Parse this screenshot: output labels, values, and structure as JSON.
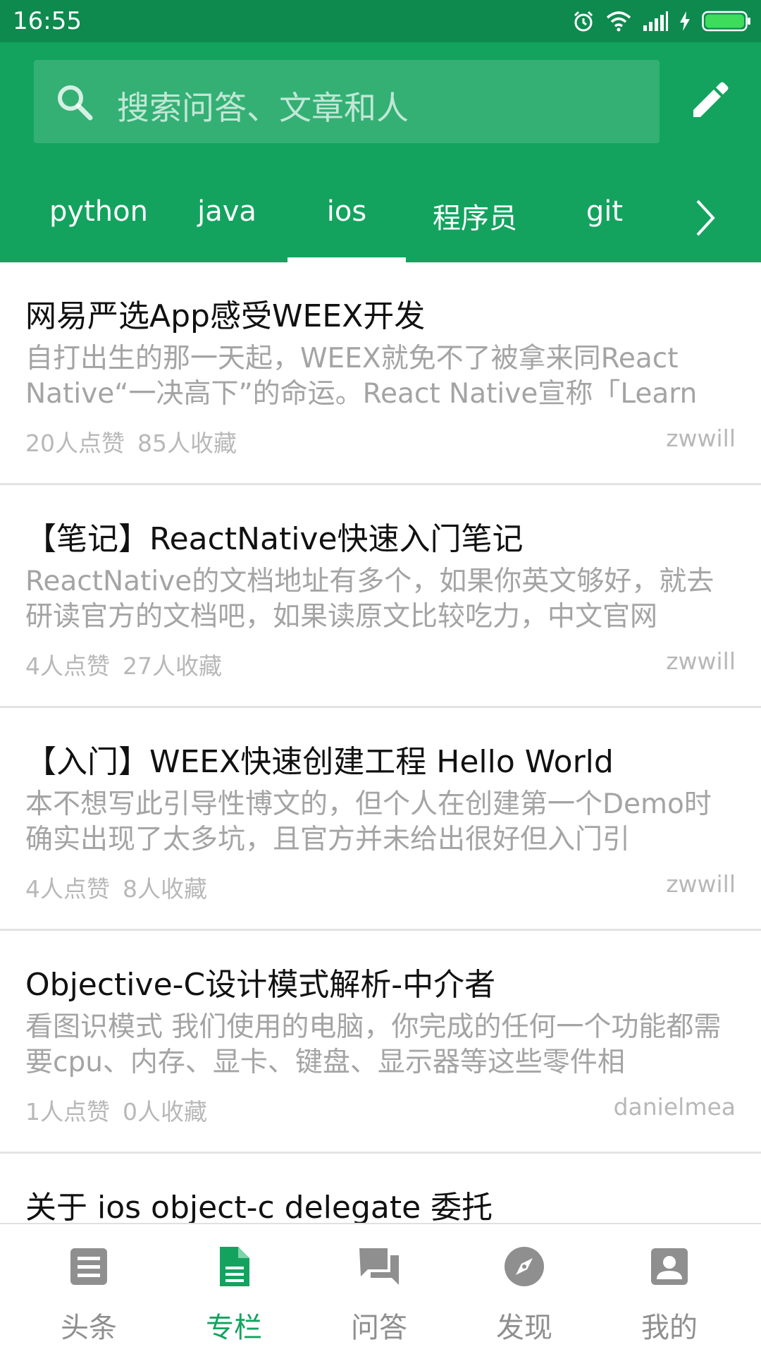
{
  "status_bar": {
    "time": "16:55",
    "icons": [
      "alarm-icon",
      "wifi-icon",
      "signal-icon",
      "charging-icon",
      "battery-icon"
    ],
    "battery_color": "#3ddc5a"
  },
  "colors": {
    "brand": "#13a35f",
    "status_bar": "#0e8a4f",
    "text_primary": "#111111",
    "text_secondary": "#a4a4a4",
    "nav_inactive": "#8f8f8f"
  },
  "search": {
    "placeholder": "搜索问答、文章和人",
    "icon": "search-icon",
    "action_icon": "edit-icon"
  },
  "tabs": [
    {
      "label": "python",
      "active": false
    },
    {
      "label": "java",
      "active": false
    },
    {
      "label": "ios",
      "active": true
    },
    {
      "label": "程序员",
      "active": false
    },
    {
      "label": "git",
      "active": false
    }
  ],
  "tabs_more_icon": "chevron-right-icon",
  "articles": [
    {
      "title": "网易严选App感受WEEX开发",
      "summary": "自打出生的那一天起，WEEX就免不了被拿来同React Native“一决高下”的命运。React Native宣称「Learn",
      "likes": "20人点赞",
      "favorites": "85人收藏",
      "author": "zwwill"
    },
    {
      "title": "【笔记】ReactNative快速入门笔记",
      "summary": "ReactNative的文档地址有多个，如果你英文够好，就去研读官方的文档吧，如果读原文比较吃力，中文官网",
      "likes": "4人点赞",
      "favorites": "27人收藏",
      "author": "zwwill"
    },
    {
      "title": "【入门】WEEX快速创建工程 Hello World",
      "summary": "本不想写此引导性博文的，但个人在创建第一个Demo时确实出现了太多坑，且官方并未给出很好但入门引",
      "likes": "4人点赞",
      "favorites": "8人收藏",
      "author": "zwwill"
    },
    {
      "title": "Objective-C设计模式解析-中介者",
      "summary": "看图识模式 我们使用的电脑，你完成的任何一个功能都需要cpu、内存、显卡、键盘、显示器等这些零件相",
      "likes": "1人点赞",
      "favorites": "0人收藏",
      "author": "danielmea"
    },
    {
      "title": "关于 ios object-c delegate 委托",
      "summary": "",
      "likes": "",
      "favorites": "",
      "author": ""
    }
  ],
  "bottom_nav": [
    {
      "label": "头条",
      "icon": "news-icon",
      "active": false
    },
    {
      "label": "专栏",
      "icon": "document-icon",
      "active": true
    },
    {
      "label": "问答",
      "icon": "chat-icon",
      "active": false
    },
    {
      "label": "发现",
      "icon": "compass-icon",
      "active": false
    },
    {
      "label": "我的",
      "icon": "profile-icon",
      "active": false
    }
  ]
}
